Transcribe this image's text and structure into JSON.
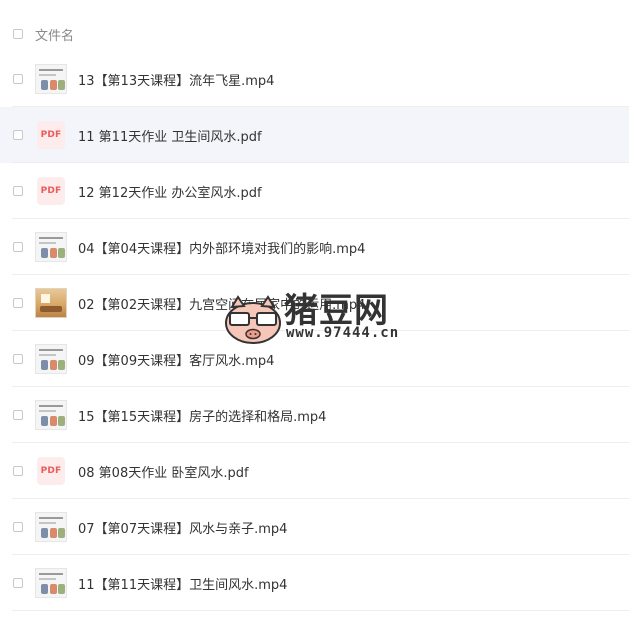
{
  "header": {
    "label": "文件名"
  },
  "files": [
    {
      "name": "13【第13天课程】流年飞星.mp4",
      "type": "video",
      "highlight": false
    },
    {
      "name": "11 第11天作业 卫生间风水.pdf",
      "type": "pdf",
      "highlight": true
    },
    {
      "name": "12 第12天作业 办公室风水.pdf",
      "type": "pdf",
      "highlight": false
    },
    {
      "name": "04【第04天课程】内外部环境对我们的影响.mp4",
      "type": "video",
      "highlight": false
    },
    {
      "name": "02【第02天课程】九宫空间在居家中的运用.mp4",
      "type": "room",
      "highlight": false
    },
    {
      "name": "09【第09天课程】客厅风水.mp4",
      "type": "video",
      "highlight": false
    },
    {
      "name": "15【第15天课程】房子的选择和格局.mp4",
      "type": "video",
      "highlight": false
    },
    {
      "name": "08 第08天作业 卧室风水.pdf",
      "type": "pdf",
      "highlight": false
    },
    {
      "name": "07【第07天课程】风水与亲子.mp4",
      "type": "video",
      "highlight": false
    },
    {
      "name": "11【第11天课程】卫生间风水.mp4",
      "type": "video",
      "highlight": false
    }
  ],
  "pdf_badge": "PDF",
  "watermark": {
    "title": "猪豆网",
    "url": "www.97444.cn"
  },
  "colors": {
    "pdf_text": "#ec5a5a",
    "pdf_bg": "#fdecec",
    "highlight_row": "#f4f4fb"
  }
}
